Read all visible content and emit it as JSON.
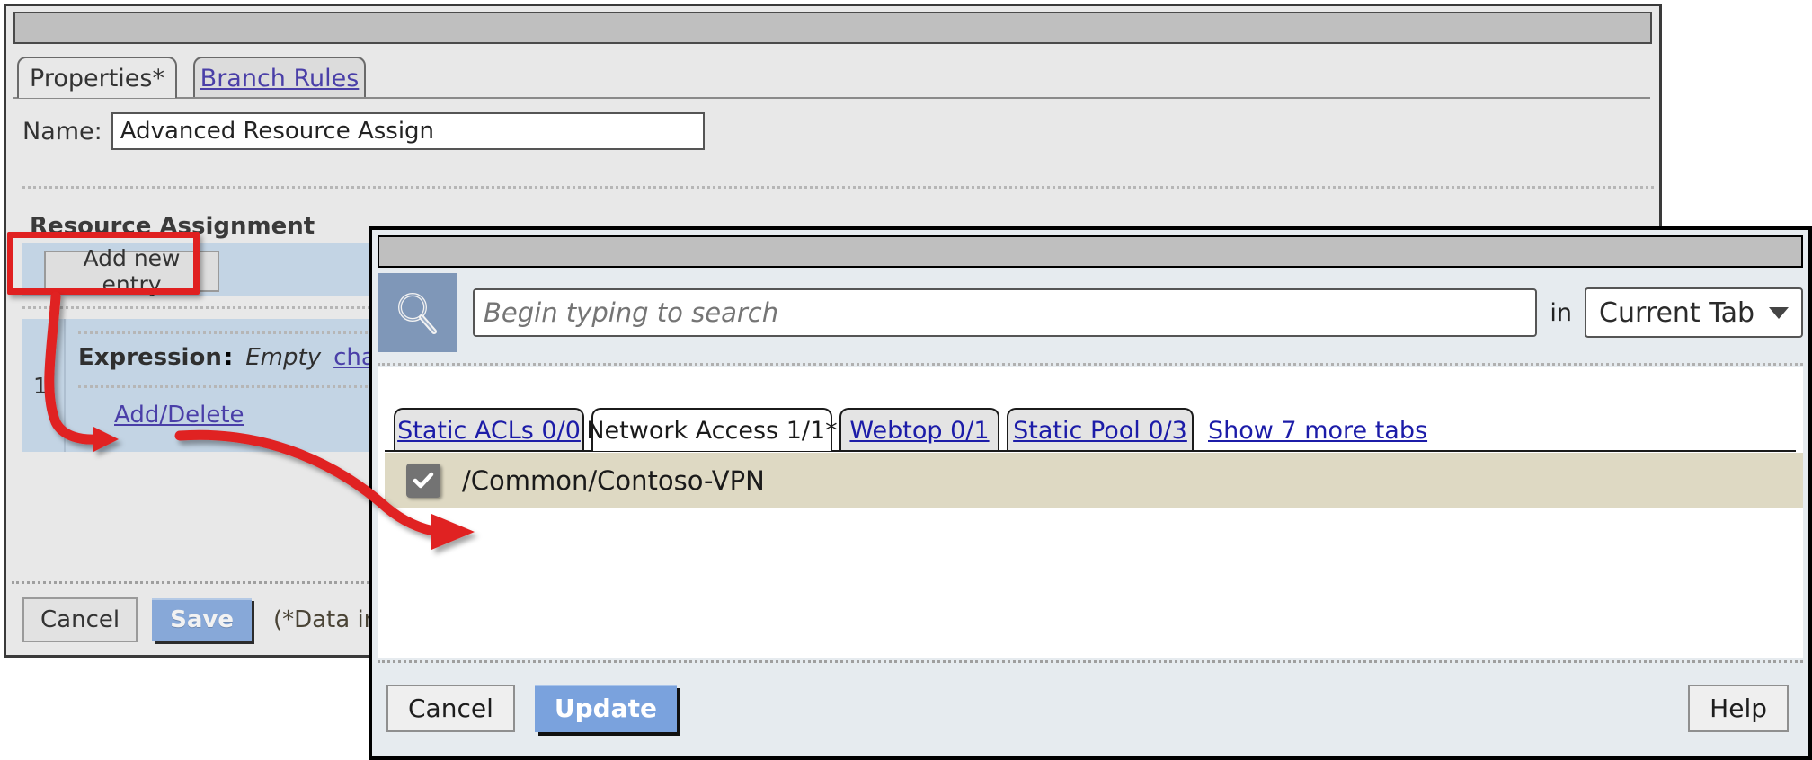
{
  "back_dialog": {
    "tabs": [
      {
        "label": "Properties*",
        "active": true,
        "is_link": false
      },
      {
        "label": "Branch Rules",
        "active": false,
        "is_link": true
      }
    ],
    "name_label": "Name:",
    "name_value": "Advanced Resource Assign",
    "section_title": "Resource Assignment",
    "add_new_entry_label": "Add new entry",
    "entry_number": "1",
    "expression_label": "Expression",
    "expression_separator": ":",
    "expression_value": "Empty",
    "expression_change_link": "change",
    "add_delete_link": "Add/Delete",
    "cancel_label": "Cancel",
    "save_label": "Save",
    "save_note": "(*Data in tab has"
  },
  "front_dialog": {
    "search": {
      "icon": "magnifier-icon",
      "placeholder": "Begin typing to search",
      "value": "",
      "in_label": "in",
      "scope_value": "Current Tab"
    },
    "tabs": [
      {
        "label": "Static ACLs 0/0",
        "active": false
      },
      {
        "label": "Network Access 1/1*",
        "active": true
      },
      {
        "label": "Webtop 0/1",
        "active": false
      },
      {
        "label": "Static Pool 0/3",
        "active": false
      }
    ],
    "show_more_tabs_label": "Show 7 more tabs",
    "results": [
      {
        "label": "/Common/Contoso-VPN",
        "checked": true
      }
    ],
    "cancel_label": "Cancel",
    "update_label": "Update",
    "help_label": "Help"
  },
  "annotation": {
    "color": "#e02020",
    "highlight_target": "add-new-entry-button"
  }
}
